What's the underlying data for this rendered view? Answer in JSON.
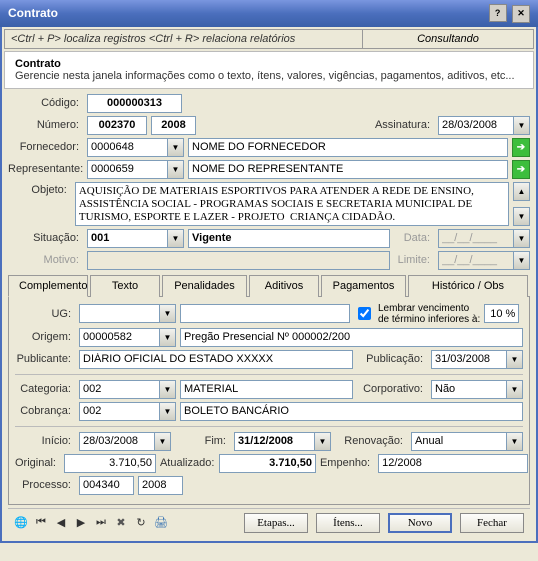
{
  "window": {
    "title": "Contrato"
  },
  "hints": {
    "left": "<Ctrl + P> localiza registros  <Ctrl + R> relaciona relatórios",
    "right": "Consultando"
  },
  "info": {
    "title": "Contrato",
    "desc": "Gerencie nesta janela informações como o texto, ítens, valores, vigências, pagamentos, aditivos, etc..."
  },
  "labels": {
    "codigo": "Código:",
    "numero": "Número:",
    "assinatura": "Assinatura:",
    "fornecedor": "Fornecedor:",
    "representante": "Representante:",
    "objeto": "Objeto:",
    "situacao": "Situação:",
    "data": "Data:",
    "motivo": "Motivo:",
    "limite": "Limite:",
    "ug": "UG:",
    "lembrar1": "Lembrar vencimento",
    "lembrar2": "de término inferiores à:",
    "origem": "Origem:",
    "publicante": "Publicante:",
    "publicacao": "Publicação:",
    "categoria": "Categoria:",
    "corporativo": "Corporativo:",
    "cobranca": "Cobrança:",
    "inicio": "Início:",
    "fim": "Fim:",
    "renovacao": "Renovação:",
    "original": "Original:",
    "atualizado": "Atualizado:",
    "empenho": "Empenho:",
    "processo": "Processo:"
  },
  "values": {
    "codigo": "000000313",
    "numero": "002370",
    "numero_ano": "2008",
    "assinatura": "28/03/2008",
    "fornecedor_cod": "0000648",
    "fornecedor_nome": "NOME DO FORNECEDOR",
    "representante_cod": "0000659",
    "representante_nome": "NOME DO REPRESENTANTE",
    "objeto": "AQUISIÇÃO DE MATERIAIS ESPORTIVOS PARA ATENDER A REDE DE ENSINO, ASSISTÊNCIA SOCIAL - PROGRAMAS SOCIAIS E SECRETARIA MUNICIPAL DE TURISMO, ESPORTE E LAZER - PROJETO  CRIANÇA CIDADÃO.",
    "situacao_cod": "001",
    "situacao_txt": "Vigente",
    "data": "__/__/____",
    "motivo": "",
    "limite": "__/__/____",
    "ug": "",
    "lembrar_checked": true,
    "lembrar_pct": "10 %",
    "origem_cod": "00000582",
    "origem_txt": "Pregão Presencial Nº 000002/200",
    "publicante": "DIÁRIO OFICIAL DO ESTADO XXXXX",
    "publicacao": "31/03/2008",
    "categoria_cod": "002",
    "categoria_txt": "MATERIAL",
    "corporativo": "Não",
    "cobranca_cod": "002",
    "cobranca_txt": "BOLETO BANCÁRIO",
    "inicio": "28/03/2008",
    "fim": "31/12/2008",
    "renovacao": "Anual",
    "original": "3.710,50",
    "atualizado": "3.710,50",
    "empenho": "12/2008",
    "processo_num": "004340",
    "processo_ano": "2008"
  },
  "tabs": {
    "complemento": "Complemento",
    "texto": "Texto",
    "penalidades": "Penalidades",
    "aditivos": "Aditivos",
    "pagamentos": "Pagamentos",
    "historico": "Histórico / Obs"
  },
  "buttons": {
    "etapas": "Etapas...",
    "itens": "Ítens...",
    "novo": "Novo",
    "fechar": "Fechar"
  }
}
